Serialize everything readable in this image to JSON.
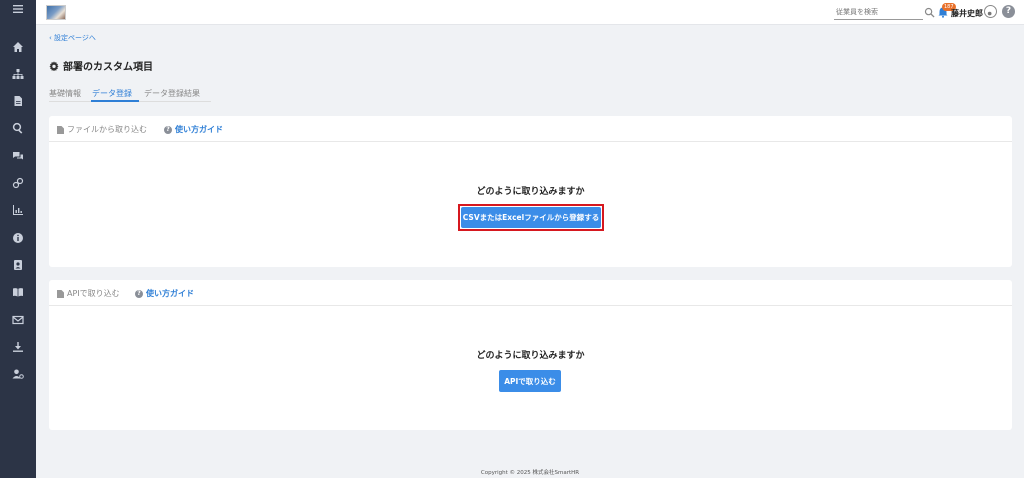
{
  "header": {
    "search_placeholder": "従業員を検索",
    "notification_count": "187",
    "user_name": "藤井史郎",
    "help_label": "?"
  },
  "nav": {
    "back_link": "設定ページへ",
    "page_title": "部署のカスタム項目"
  },
  "tabs": [
    {
      "label": "基礎情報"
    },
    {
      "label": "データ登録"
    },
    {
      "label": "データ登録結果"
    }
  ],
  "file_import": {
    "title": "ファイルから取り込む",
    "guide_label": "使い方ガイド",
    "question": "どのように取り込みますか",
    "button_label": "CSVまたはExcelファイルから登録する"
  },
  "api_import": {
    "title": "APIで取り込む",
    "guide_label": "使い方ガイド",
    "question": "どのように取り込みますか",
    "button_label": "APIで取り込む"
  },
  "footer": {
    "copyright": "Copyright © 2025 株式会社SmartHR"
  },
  "colors": {
    "sidebar": "#2c3446",
    "accent": "#2f7fd6",
    "button": "#3b8de8",
    "highlight": "#d6181f",
    "badge": "#e8702a"
  },
  "icons": [
    "menu-icon",
    "home-icon",
    "org-chart-icon",
    "document-icon",
    "search-icon",
    "chat-icon",
    "link-icon",
    "chart-icon",
    "info-icon",
    "contact-icon",
    "book-icon",
    "mail-icon",
    "download-icon",
    "user-settings-icon"
  ]
}
